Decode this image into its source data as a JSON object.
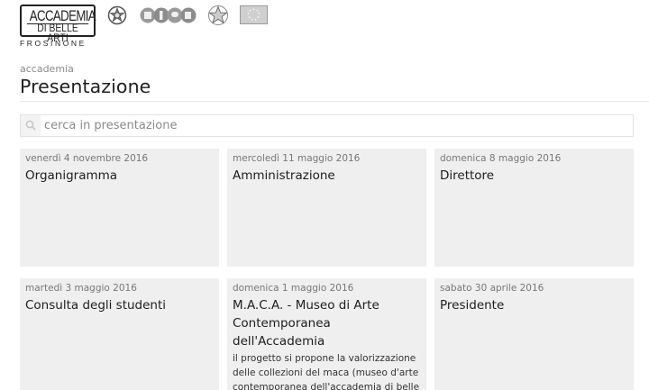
{
  "header": {
    "logo": {
      "line1": "ACCADEMIA",
      "line2": "DI BELLE ARTI",
      "city": "FROSINONE"
    },
    "partner_logos": [
      "italian-republic-emblem-icon",
      "miur-logo",
      "star-emblem-icon",
      "eu-flag-icon"
    ]
  },
  "breadcrumb": "accademia",
  "page_title": "Presentazione",
  "search": {
    "placeholder": "cerca in presentazione",
    "icon": "search-icon"
  },
  "cards": [
    {
      "date": "venerdì 4 novembre 2016",
      "title": "Organigramma"
    },
    {
      "date": "mercoledì 11 maggio 2016",
      "title": "Amministrazione"
    },
    {
      "date": "domenica 8 maggio 2016",
      "title": "Direttore"
    },
    {
      "date": "martedì 3 maggio 2016",
      "title": "Consulta degli studenti"
    },
    {
      "date": "domenica 1 maggio 2016",
      "title": "M.A.C.A. - Museo di Arte Contemporanea dell'Accademia",
      "excerpt": "il progetto si propone la valorizzazione delle collezioni del maca (museo d'arte contemporanea dell'accademia di belle arti di frosinone) con un piano di"
    },
    {
      "date": "sabato 30 aprile 2016",
      "title": "Presidente"
    }
  ],
  "colors": {
    "card_background": "#efefef",
    "text": "#1d1d1d",
    "muted": "#777777"
  }
}
